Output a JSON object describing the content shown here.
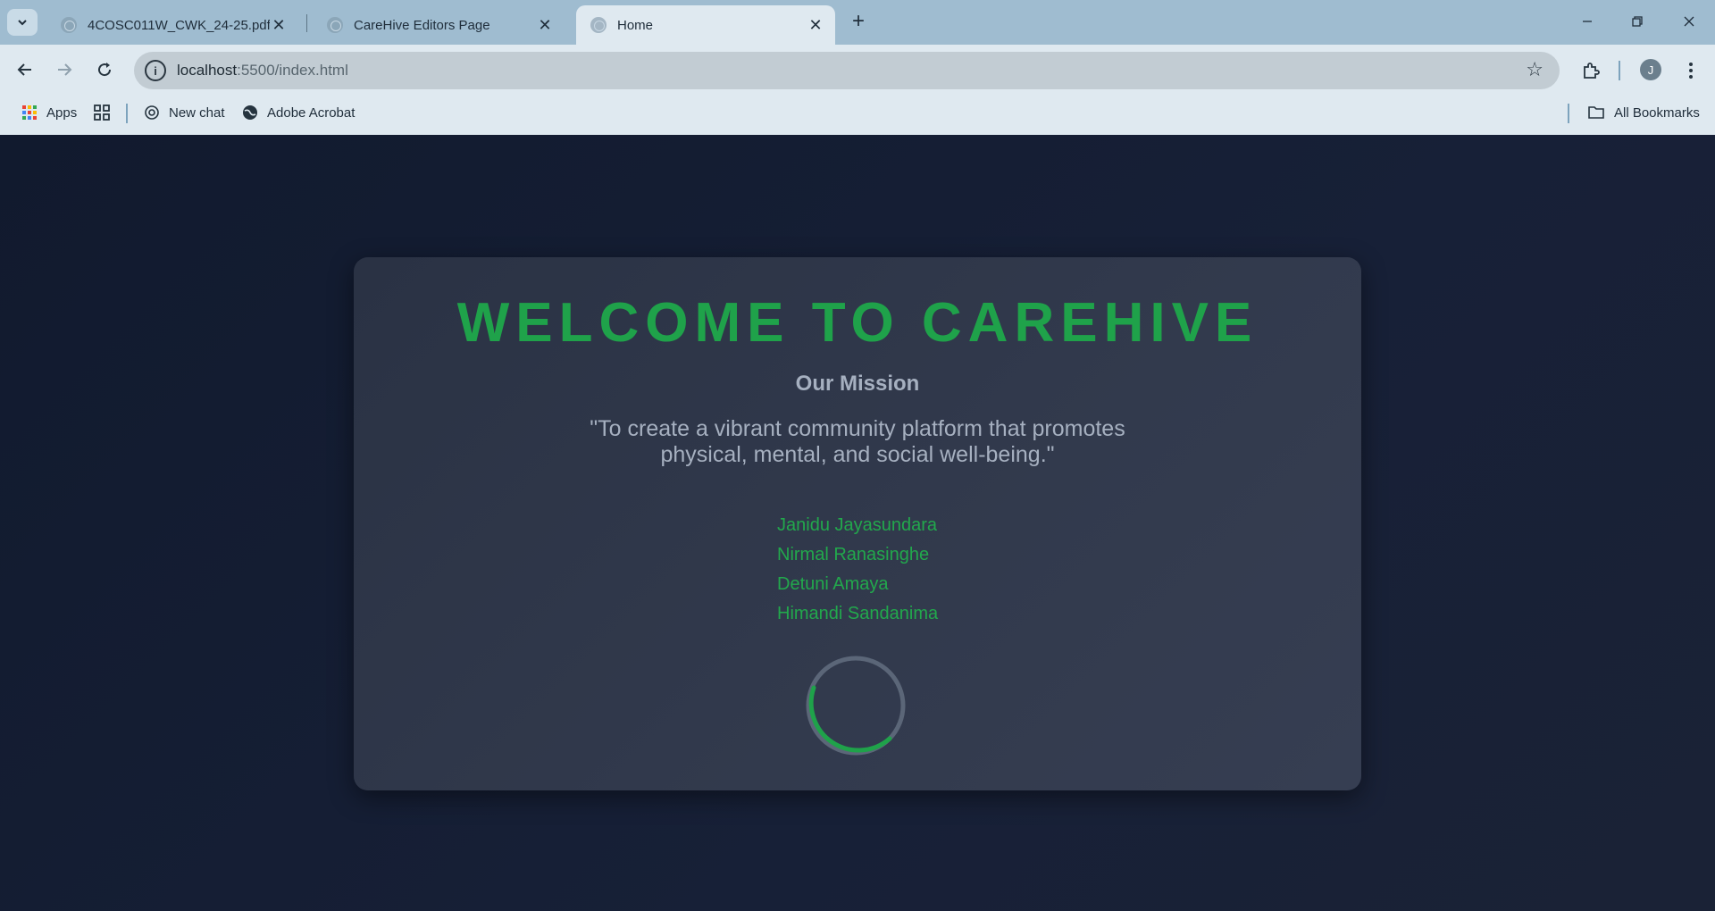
{
  "browser": {
    "tabs": [
      {
        "title": "4COSC011W_CWK_24-25.pdf",
        "active": false
      },
      {
        "title": "CareHive Editors Page",
        "active": false
      },
      {
        "title": "Home",
        "active": true
      }
    ],
    "url_host": "localhost",
    "url_path": ":5500/index.html",
    "avatar_initial": "J",
    "bookmarks": {
      "apps": "Apps",
      "new_chat": "New chat",
      "adobe": "Adobe Acrobat",
      "all": "All Bookmarks"
    }
  },
  "page": {
    "headline": "WELCOME TO CAREHIVE",
    "mission_title": "Our Mission",
    "mission_text": "\"To create a vibrant community platform that promotes physical, mental, and social well-being.\"",
    "team": [
      "Janidu Jayasundara",
      "Nirmal Ranasinghe",
      "Detuni Amaya",
      "Himandi Sandanima"
    ]
  },
  "colors": {
    "accent": "#1fa24a",
    "page_background": "#111a2e",
    "card_background": "#2f374a",
    "muted_text": "#a6b0c0"
  }
}
